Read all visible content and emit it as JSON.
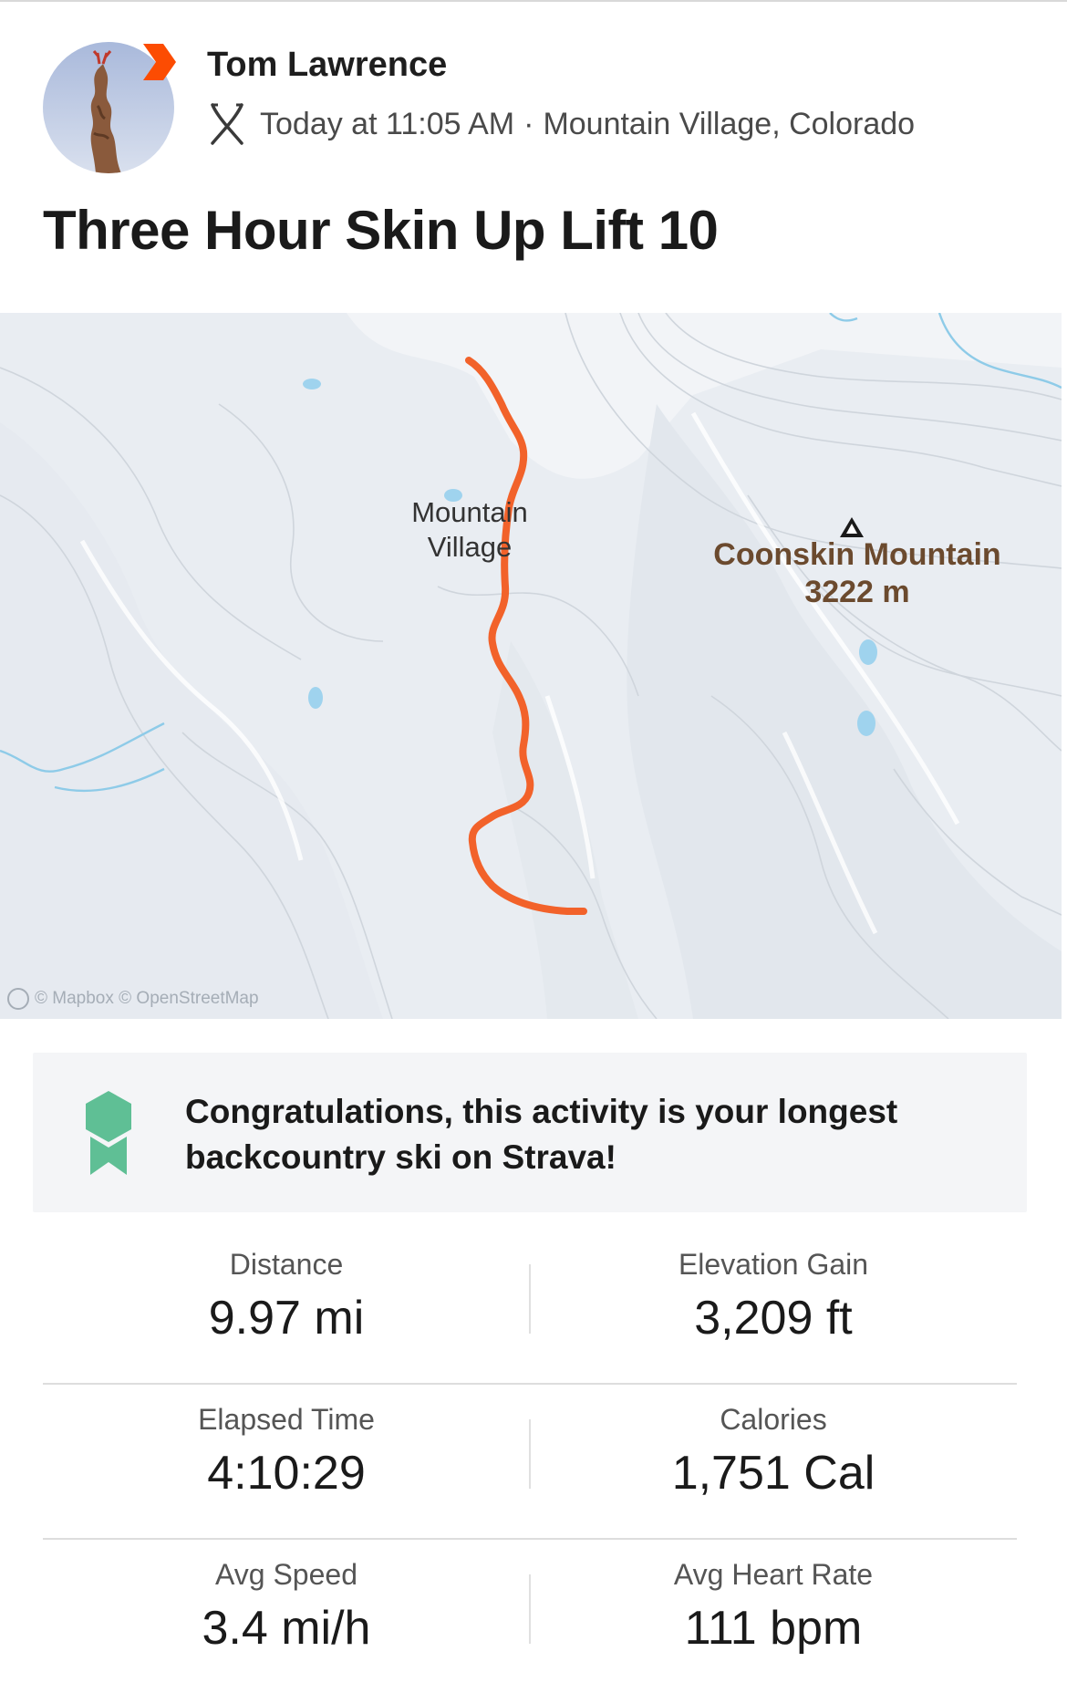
{
  "athlete": {
    "name": "Tom Lawrence",
    "timestamp": "Today at 11:05 AM",
    "separator": "·",
    "location": "Mountain Village, Colorado",
    "avatar_icon": "avatar-photo",
    "badge_icon": "subscriber-chevron-icon",
    "sport_icon": "backcountry-ski-icon"
  },
  "activity": {
    "title": "Three Hour Skin Up Lift 10"
  },
  "map": {
    "places": {
      "village_line1": "Mountain",
      "village_line2": "Village",
      "peak_name": "Coonskin Mountain",
      "peak_elevation": "3222 m"
    },
    "attribution": "© Mapbox © OpenStreetMap",
    "route_color": "#f2622a"
  },
  "achievement": {
    "icon": "award-ribbon-icon",
    "color": "#5fbf95",
    "text": "Congratulations, this activity is your longest backcountry ski on Strava!"
  },
  "stats": {
    "distance": {
      "label": "Distance",
      "value": "9.97 mi"
    },
    "elevation_gain": {
      "label": "Elevation Gain",
      "value": "3,209 ft"
    },
    "elapsed_time": {
      "label": "Elapsed Time",
      "value": "4:10:29"
    },
    "calories": {
      "label": "Calories",
      "value": "1,751 Cal"
    },
    "avg_speed": {
      "label": "Avg Speed",
      "value": "3.4 mi/h"
    },
    "avg_heart_rate": {
      "label": "Avg Heart Rate",
      "value": "111 bpm"
    }
  },
  "colors": {
    "brand_orange": "#fc4c02",
    "text_primary": "#1a1a1a",
    "text_secondary": "#4a4a4a"
  }
}
